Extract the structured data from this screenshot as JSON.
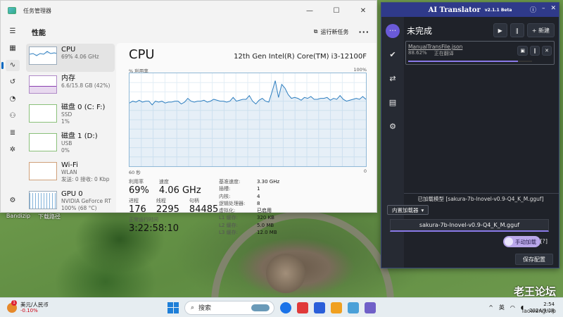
{
  "desktop": {
    "icons": [
      {
        "label": "Bandizip",
        "color": "#3b7fd4"
      },
      {
        "label": "下载路径",
        "color": "#f0c247"
      }
    ],
    "watermark": "老王论坛",
    "watermark_sub": "laowang.vip"
  },
  "task_manager": {
    "title": "任务管理器",
    "win_ctrls": [
      "—",
      "☐",
      "✕"
    ],
    "section": "性能",
    "run_task_label": "运行新任务",
    "more_label": "···",
    "rail_icons": [
      "menu-icon",
      "processes-icon",
      "performance-icon",
      "history-icon",
      "startup-icon",
      "users-icon",
      "details-icon",
      "services-icon",
      "settings-icon"
    ],
    "items": [
      {
        "name": "CPU",
        "sub": "69% 4.06 GHz",
        "color": "#2f7fc0"
      },
      {
        "name": "内存",
        "sub": "6.6/15.8 GB (42%)",
        "color": "#8a3fb0"
      },
      {
        "name": "磁盘 0 (C: F:)",
        "sub": "SSD",
        "sub2": "1%",
        "color": "#4a9a3a"
      },
      {
        "name": "磁盘 1 (D:)",
        "sub": "USB",
        "sub2": "0%",
        "color": "#4a9a3a"
      },
      {
        "name": "Wi-Fi",
        "sub": "WLAN",
        "sub2": "发送: 0 接收: 0 Kbp",
        "color": "#b06a2a"
      },
      {
        "name": "GPU 0",
        "sub": "NVIDIA GeForce RT",
        "sub2": "100% (68 °C)",
        "color": "#2f7fc0"
      }
    ],
    "main": {
      "title": "CPU",
      "model": "12th Gen Intel(R) Core(TM) i3-12100F",
      "util_label": "% 利用率",
      "util_max": "100%",
      "time_label": "60 秒",
      "time_min": "0",
      "stats": {
        "util_lbl": "利用率",
        "util_val": "69%",
        "speed_lbl": "速度",
        "speed_val": "4.06 GHz",
        "proc_lbl": "进程",
        "proc_val": "176",
        "thread_lbl": "线程",
        "thread_val": "2295",
        "handle_lbl": "句柄",
        "handle_val": "84485",
        "uptime_lbl": "正常运行时间",
        "uptime_val": "3:22:58:10"
      },
      "specs": [
        {
          "k": "基准速度:",
          "v": "3.30 GHz"
        },
        {
          "k": "插槽:",
          "v": "1"
        },
        {
          "k": "内核:",
          "v": "4"
        },
        {
          "k": "逻辑处理器:",
          "v": "8"
        },
        {
          "k": "虚拟化:",
          "v": "已启用"
        },
        {
          "k": "L1 缓存:",
          "v": "320 KB"
        },
        {
          "k": "L2 缓存:",
          "v": "5.0 MB"
        },
        {
          "k": "L3 缓存:",
          "v": "12.0 MB"
        }
      ],
      "series": [
        68,
        70,
        69,
        71,
        69,
        70,
        70,
        66,
        70,
        69,
        70,
        68,
        69,
        69,
        70,
        70,
        67,
        69,
        73,
        70,
        69,
        70,
        70,
        71,
        69,
        70,
        72,
        71,
        70,
        70,
        69,
        70,
        74,
        70,
        71,
        72,
        72,
        76,
        70,
        67,
        71,
        73,
        70,
        69,
        80,
        92,
        74,
        88,
        84,
        77,
        73,
        74,
        73,
        71,
        74,
        73,
        75,
        72,
        72,
        73,
        73,
        74,
        71,
        73,
        72,
        76,
        72,
        70,
        71,
        72,
        73,
        72,
        75,
        72
      ]
    }
  },
  "translator": {
    "title": "AI Translator",
    "version": "v2.1.1 Beta",
    "ctrls": [
      "ⓘ",
      "–",
      "✕"
    ],
    "heading": "未完成",
    "play_label": "▶",
    "pause_label": "‖",
    "new_label": "+ 新建",
    "task": {
      "file": "ManualTransFile.json",
      "percent": "88.62%",
      "status": "正在翻译",
      "progress": 0.8862
    },
    "task_btns": [
      "▣",
      "‖",
      "✕"
    ],
    "loaded_model_text": "已加载模型 [sakura-7b-lnovel-v0.9-Q4_K_M.gguf]",
    "loader": "内置加载器",
    "model_file": "sakura-7b-lnovel-v0.9-Q4_K_M.gguf",
    "manual_load": "手动加载",
    "help": "[?]",
    "save": "保存配置",
    "accent": "#6a5ad8"
  },
  "taskbar": {
    "fx_badge": "1",
    "fx_name": "美元/人民币",
    "fx_change": "-0.10%",
    "search_placeholder": "搜索",
    "lang": "英",
    "time": "2:54",
    "date": "2024/9/18"
  }
}
